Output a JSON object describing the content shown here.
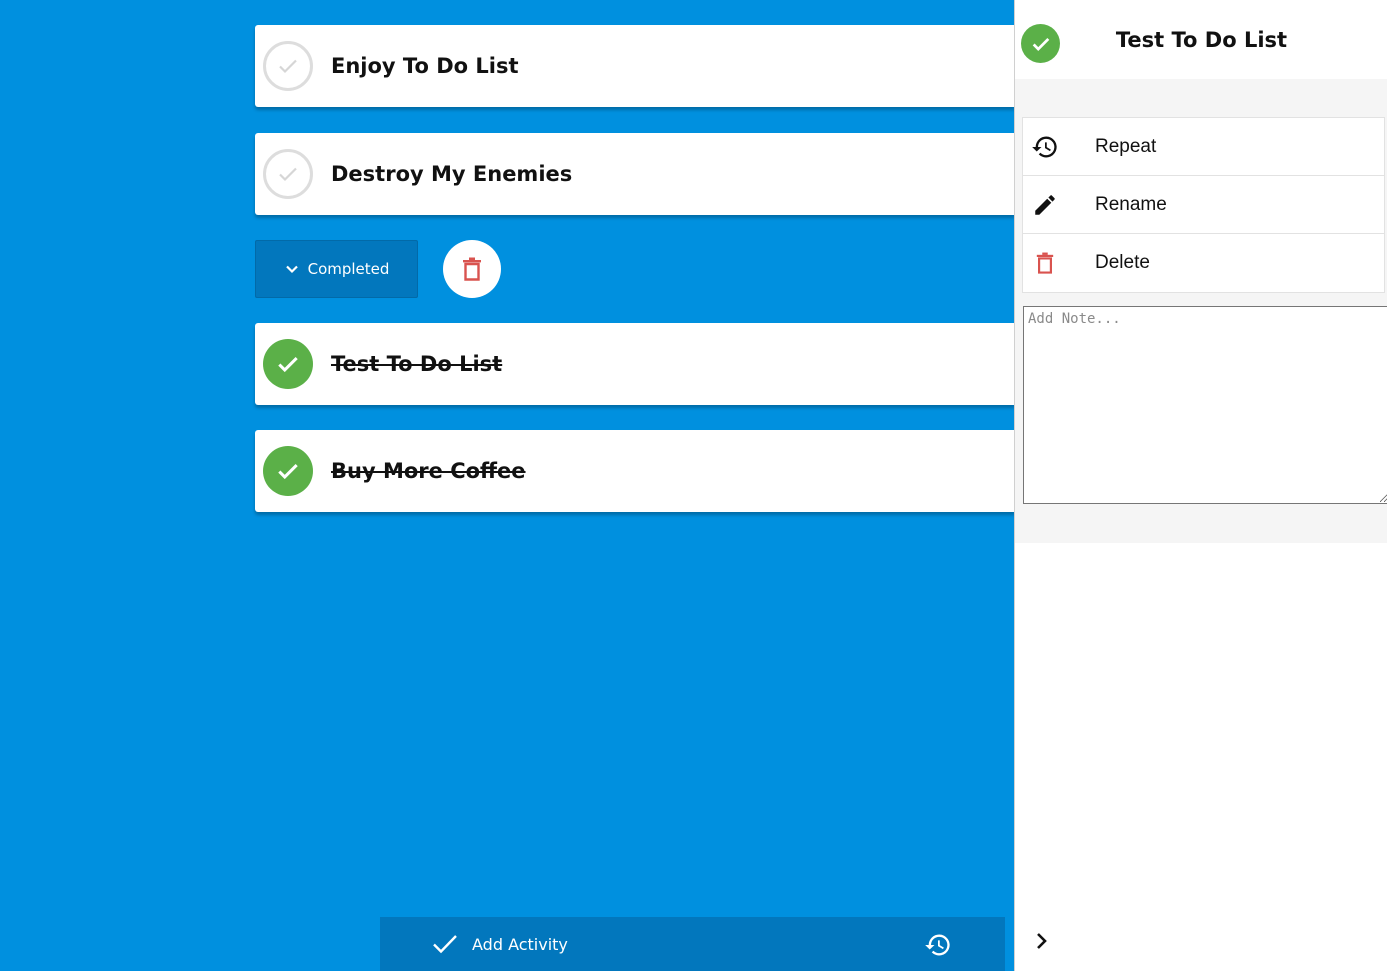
{
  "tasks": {
    "open": [
      {
        "title": "Enjoy To Do List"
      },
      {
        "title": "Destroy My Enemies"
      }
    ],
    "completed_toggle_label": "Completed",
    "completed": [
      {
        "title": "Test To Do List"
      },
      {
        "title": "Buy More Coffee"
      }
    ]
  },
  "bottom_bar": {
    "add_label": "Add Activity"
  },
  "detail": {
    "title": "Test To Do List",
    "actions": [
      {
        "label": "Repeat",
        "icon": "history-icon"
      },
      {
        "label": "Rename",
        "icon": "pencil-icon"
      },
      {
        "label": "Delete",
        "icon": "trash-icon"
      }
    ],
    "note_placeholder": "Add Note..."
  },
  "colors": {
    "background": "#0090df",
    "bar": "#0277bd",
    "check_green": "#5bb048",
    "delete_red": "#d9534f"
  }
}
